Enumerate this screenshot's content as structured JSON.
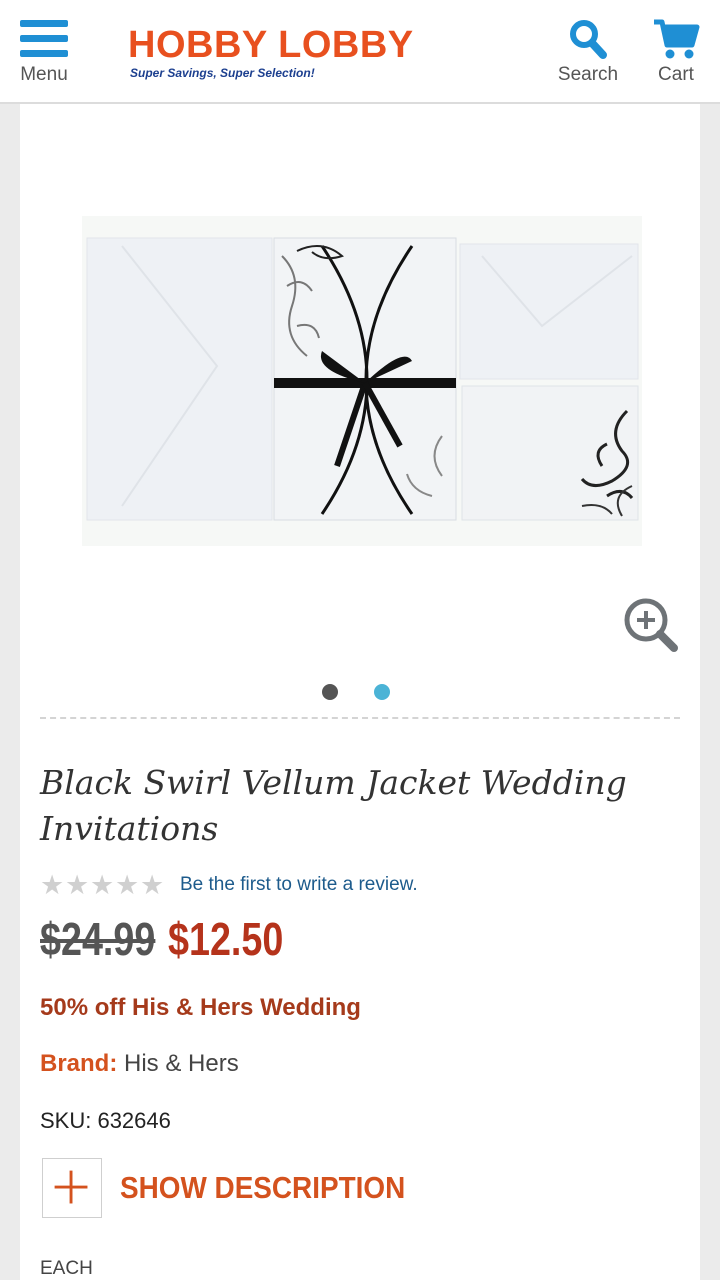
{
  "header": {
    "menu_label": "Menu",
    "logo_text": "HOBBY LOBBY",
    "logo_tagline": "Super Savings, Super Selection!",
    "search_label": "Search",
    "cart_label": "Cart",
    "accent_color": "#1f8fd4",
    "brand_color": "#e8501f"
  },
  "gallery": {
    "image_count": 2,
    "active_index": 1
  },
  "product": {
    "title": "Black Swirl Vellum Jacket Wedding Invitations",
    "rating_stars_filled": 0,
    "rating_stars_total": 5,
    "review_link": "Be the first to write a review.",
    "old_price": "$24.99",
    "new_price": "$12.50",
    "promo": "50% off His & Hers Wedding",
    "brand_label": "Brand:",
    "brand_value": "His & Hers",
    "sku_text": "SKU: 632646",
    "description_toggle": "SHOW DESCRIPTION",
    "unit_label": "EACH"
  },
  "icons": [
    "hamburger-menu-icon",
    "search-icon",
    "cart-icon",
    "zoom-in-icon",
    "plus-icon",
    "star-icon"
  ]
}
